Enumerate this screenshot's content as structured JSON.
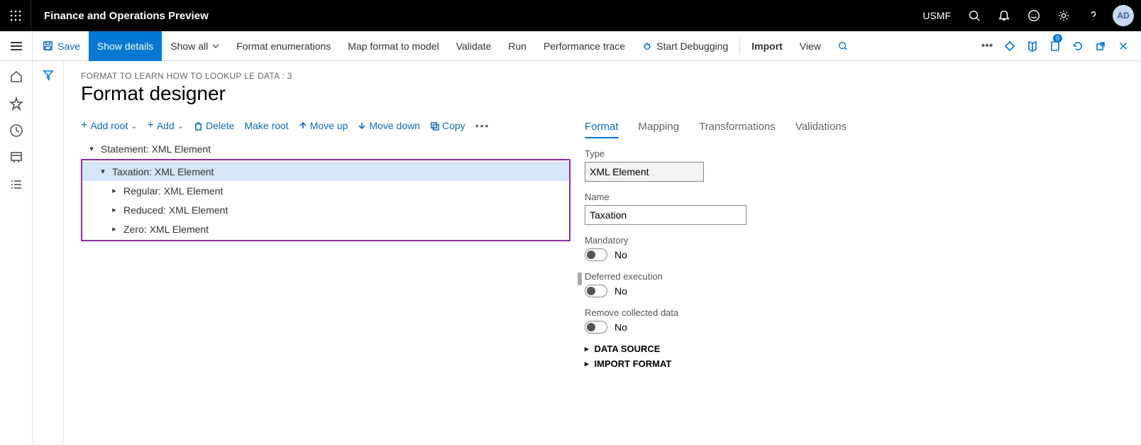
{
  "topbar": {
    "app_title": "Finance and Operations Preview",
    "company": "USMF",
    "avatar": "AD"
  },
  "cmdbar": {
    "save": "Save",
    "show_details": "Show details",
    "show_all": "Show all",
    "format_enum": "Format enumerations",
    "map": "Map format to model",
    "validate": "Validate",
    "run": "Run",
    "perf": "Performance trace",
    "debug": "Start Debugging",
    "import": "Import",
    "view": "View",
    "badge": "0"
  },
  "page": {
    "breadcrumb": "FORMAT TO LEARN HOW TO LOOKUP LE DATA : 3",
    "title": "Format designer"
  },
  "toolbar": {
    "add_root": "Add root",
    "add": "Add",
    "delete": "Delete",
    "make_root": "Make root",
    "move_up": "Move up",
    "move_down": "Move down",
    "copy": "Copy"
  },
  "tree": {
    "root": "Statement: XML Element",
    "selected": "Taxation: XML Element",
    "children": [
      "Regular: XML Element",
      "Reduced: XML Element",
      "Zero: XML Element"
    ]
  },
  "tabs": {
    "format": "Format",
    "mapping": "Mapping",
    "transformations": "Transformations",
    "validations": "Validations"
  },
  "form": {
    "type_label": "Type",
    "type_value": "XML Element",
    "name_label": "Name",
    "name_value": "Taxation",
    "mandatory_label": "Mandatory",
    "mandatory_value": "No",
    "deferred_label": "Deferred execution",
    "deferred_value": "No",
    "remove_label": "Remove collected data",
    "remove_value": "No",
    "data_source": "DATA SOURCE",
    "import_format": "IMPORT FORMAT"
  }
}
